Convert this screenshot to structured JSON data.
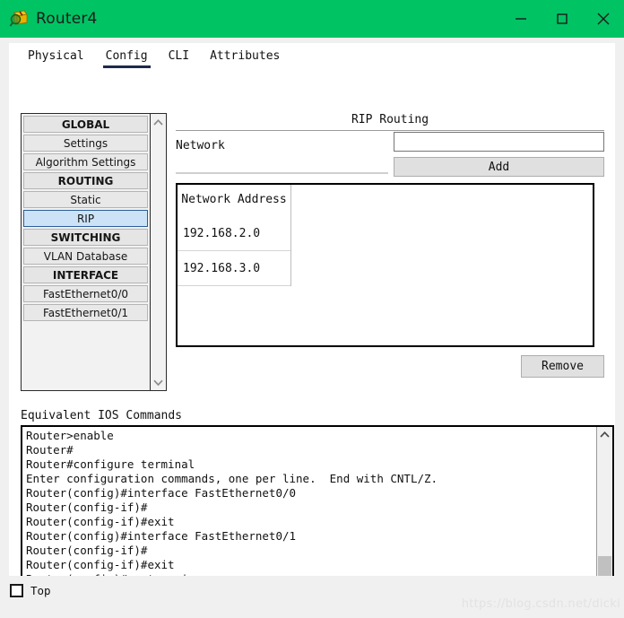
{
  "window": {
    "title": "Router4",
    "icon": "router-package-magnifier-icon",
    "titlebar_color": "#00c364",
    "minimize_label": "minimize-icon",
    "maximize_label": "maximize-icon",
    "close_label": "close-icon"
  },
  "tabs": [
    {
      "label": "Physical",
      "selected": false
    },
    {
      "label": "Config",
      "selected": true
    },
    {
      "label": "CLI",
      "selected": false
    },
    {
      "label": "Attributes",
      "selected": false
    }
  ],
  "sidebar": {
    "items": [
      {
        "label": "GLOBAL",
        "type": "group",
        "selected": false
      },
      {
        "label": "Settings",
        "type": "item",
        "selected": false
      },
      {
        "label": "Algorithm Settings",
        "type": "item",
        "selected": false
      },
      {
        "label": "ROUTING",
        "type": "group",
        "selected": false
      },
      {
        "label": "Static",
        "type": "item",
        "selected": false
      },
      {
        "label": "RIP",
        "type": "item",
        "selected": true
      },
      {
        "label": "SWITCHING",
        "type": "group",
        "selected": false
      },
      {
        "label": "VLAN Database",
        "type": "item",
        "selected": false
      },
      {
        "label": "INTERFACE",
        "type": "group",
        "selected": false
      },
      {
        "label": "FastEthernet0/0",
        "type": "item",
        "selected": false
      },
      {
        "label": "FastEthernet0/1",
        "type": "item",
        "selected": false
      }
    ],
    "selection_color": "#cce3f7",
    "scroll_up_icon": "chevron-up-icon",
    "scroll_down_icon": "chevron-down-icon"
  },
  "rip": {
    "title": "RIP Routing",
    "network_label": "Network",
    "network_value": "",
    "network_placeholder": "",
    "add_label": "Add",
    "remove_label": "Remove",
    "table": {
      "header": "Network Address",
      "rows": [
        "192.168.2.0",
        "192.168.3.0"
      ]
    }
  },
  "ios": {
    "label": "Equivalent IOS Commands",
    "lines": "Router>enable\nRouter#\nRouter#configure terminal\nEnter configuration commands, one per line.  End with CNTL/Z.\nRouter(config)#interface FastEthernet0/0\nRouter(config-if)#\nRouter(config-if)#exit\nRouter(config)#interface FastEthernet0/1\nRouter(config-if)#\nRouter(config-if)#exit\nRouter(config)#router rip\nRouter(config-router)#",
    "scroll_up_icon": "chevron-up-icon",
    "scroll_down_icon": "chevron-down-icon"
  },
  "footer": {
    "top_label": "Top",
    "top_checked": false,
    "watermark": "https://blog.csdn.net/dicki"
  }
}
